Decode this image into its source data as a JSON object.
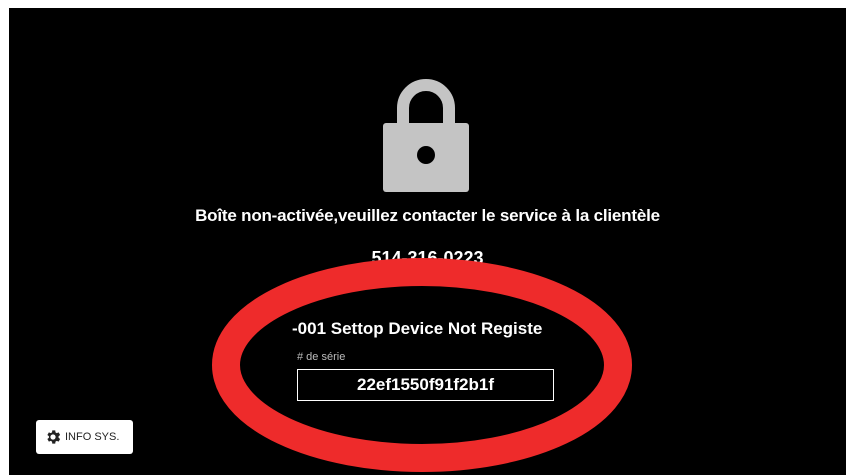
{
  "screen": {
    "message": "Boîte non-activée,veuillez contacter le service à la clientèle",
    "phone": "514-316-0223",
    "error": "-001 Settop Device Not Registe",
    "serial_label": "# de série",
    "serial_value": "22ef1550f91f2b1f"
  },
  "info_button": {
    "label": "INFO SYS.",
    "icon": "gear-icon"
  },
  "colors": {
    "background": "#000000",
    "lock": "#c4c4c4",
    "annotation": "#ee2b2b"
  }
}
